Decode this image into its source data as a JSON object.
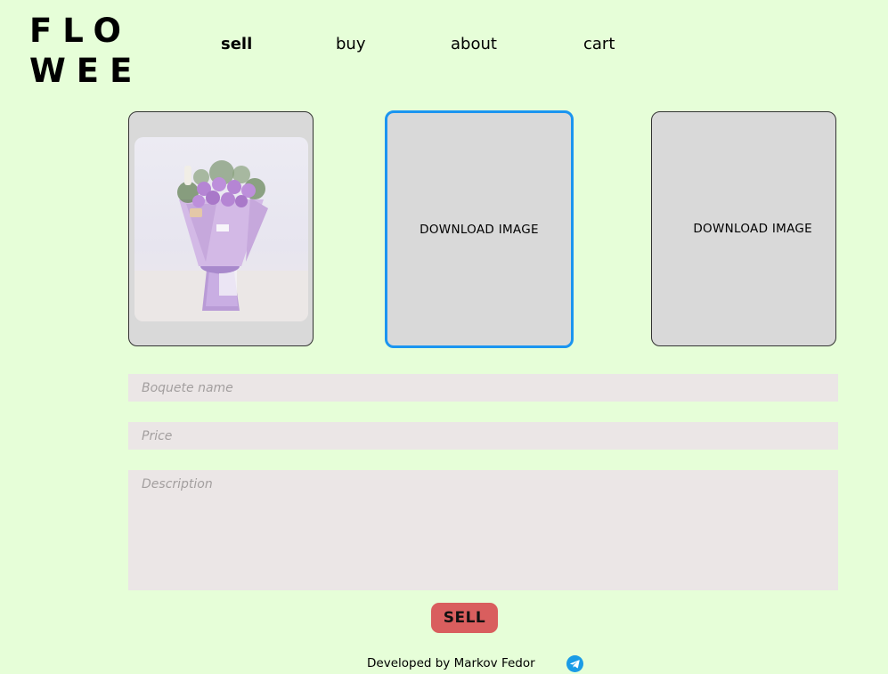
{
  "logo": {
    "line1": "FLO",
    "line2": "WEE"
  },
  "nav": {
    "sell": "sell",
    "buy": "buy",
    "about": "about",
    "cart": "cart",
    "active": "sell"
  },
  "images": {
    "slot1_kind": "uploaded bouquet photo",
    "slot2_label": "DOWNLOAD IMAGE",
    "slot3_label": "DOWNLOAD IMAGE"
  },
  "form": {
    "name_placeholder": "Boquete name",
    "price_placeholder": "Price",
    "description_placeholder": "Description",
    "submit_label": "SELL"
  },
  "footer": {
    "text": "Developed by Markov Fedor",
    "icon": "telegram-icon"
  },
  "colors": {
    "background": "#e6fed8",
    "sell_button": "#d95e5e",
    "selected_border": "#1b95f0",
    "card": "#d9d9d9",
    "field": "#ebe6e6"
  }
}
